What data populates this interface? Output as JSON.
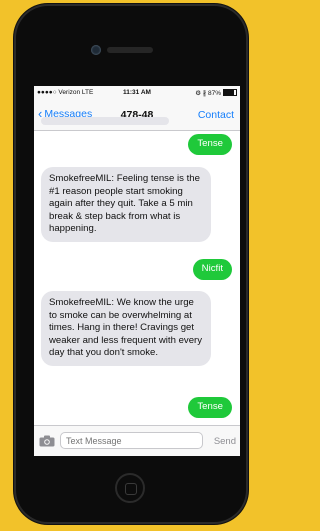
{
  "status_bar": {
    "carrier": "●●●●○ Verizon  LTE",
    "time": "11:31 AM",
    "battery_text": "⚙ ∦ 87%",
    "battery_level": 0.87
  },
  "nav": {
    "back_label": "Messages",
    "title": "478-48",
    "contact_label": "Contact"
  },
  "messages": [
    {
      "direction": "outgoing",
      "text": "Tense"
    },
    {
      "direction": "incoming",
      "text": "SmokefreeMIL: Feeling tense is the #1 reason people start smoking again after they quit. Take a 5 min break & step back from what is happening."
    },
    {
      "direction": "outgoing",
      "text": "Nicfit"
    },
    {
      "direction": "incoming",
      "text": "SmokefreeMIL: We know the urge to smoke can be overwhelming at times. Hang in there! Cravings get weaker and less frequent with every day that you don't smoke."
    },
    {
      "direction": "outgoing",
      "text": "Tense"
    }
  ],
  "input": {
    "placeholder": "Text Message",
    "send_label": "Send"
  },
  "colors": {
    "background": "#F2C22A",
    "accent": "#157EFB",
    "outgoing_bubble": "#1FC93A",
    "incoming_bubble": "#E5E5EA"
  },
  "icons": {
    "camera": "camera-icon",
    "back": "chevron-left-icon",
    "home": "home-button-icon"
  }
}
